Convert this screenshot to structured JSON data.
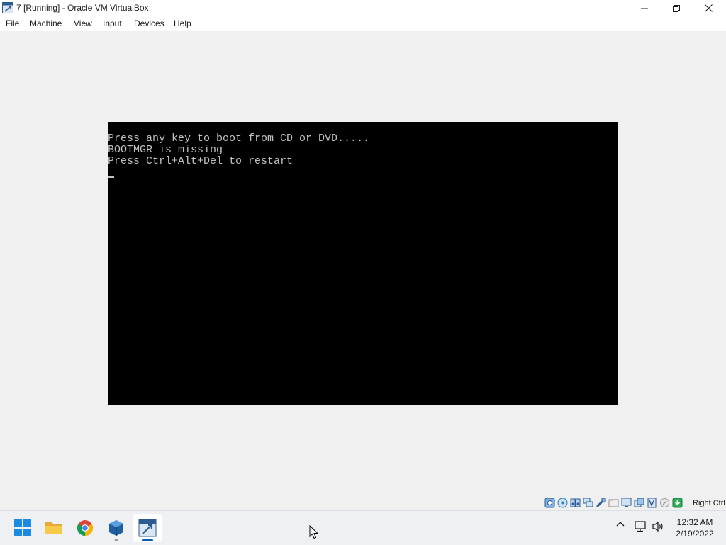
{
  "window": {
    "title": "7 [Running] - Oracle VM VirtualBox",
    "icon": "virtualbox-vm-icon",
    "controls": [
      "minimize-icon",
      "restore-icon",
      "close-icon"
    ]
  },
  "menu": {
    "file": "File",
    "machine": "Machine",
    "view": "View",
    "input": "Input",
    "devices": "Devices",
    "help": "Help"
  },
  "console": {
    "lines": [
      "Press any key to boot from CD or DVD.....",
      "BOOTMGR is missing",
      "Press Ctrl+Alt+Del to restart"
    ]
  },
  "statusbar": {
    "icons": [
      "hard-disk-icon",
      "optical-drive-icon",
      "audio-icon",
      "network-icon",
      "usb-icon",
      "shared-folders-icon",
      "display-icon",
      "video-capture-icon",
      "cpu-icon",
      "mouse-integration-icon",
      "keyboard-icon"
    ],
    "host_key": "Right Ctrl"
  },
  "taskbar": {
    "apps": [
      "windows-start-icon",
      "file-explorer-icon",
      "chrome-icon",
      "virtualbox-manager-icon",
      "virtualbox-vm-icon"
    ],
    "tray_icons": [
      "chevron-up-icon",
      "network-icon",
      "speaker-icon"
    ],
    "time": "12:32 AM",
    "date": "2/19/2022"
  },
  "colors": {
    "console_bg": "#000000",
    "console_text": "#c0c0c0",
    "window_bg": "#f0f0f0",
    "accent": "#005fb8"
  }
}
